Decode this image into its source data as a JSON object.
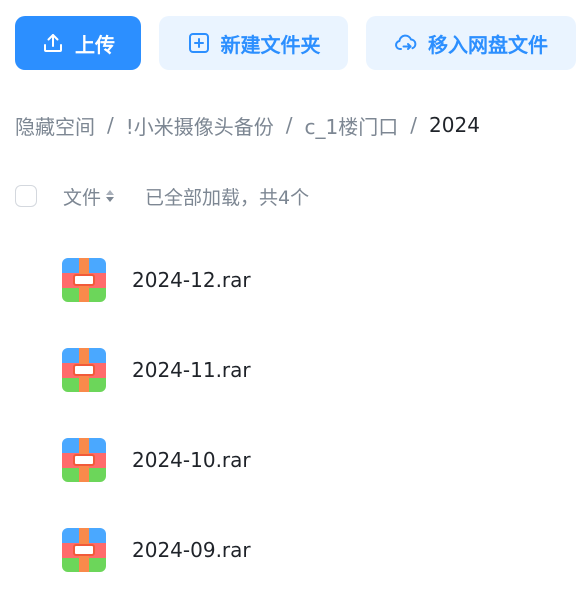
{
  "toolbar": {
    "upload_label": "上传",
    "upload_icon": "upload-icon",
    "new_folder_label": "新建文件夹",
    "new_folder_icon": "add-folder-icon",
    "move_label": "移入网盘文件",
    "move_icon": "cloud-transfer-icon",
    "accent_color": "#2c8fff"
  },
  "breadcrumb": {
    "items": [
      "隐藏空间",
      "!小米摄像头备份",
      "c_1楼门口",
      "2024"
    ],
    "separator": "/"
  },
  "list_header": {
    "column_label": "文件",
    "sort_icon": "sort-icon",
    "status": "已全部加载，共4个"
  },
  "files": [
    {
      "name": "2024-12.rar",
      "icon": "archive-icon"
    },
    {
      "name": "2024-11.rar",
      "icon": "archive-icon"
    },
    {
      "name": "2024-10.rar",
      "icon": "archive-icon"
    },
    {
      "name": "2024-09.rar",
      "icon": "archive-icon"
    }
  ]
}
